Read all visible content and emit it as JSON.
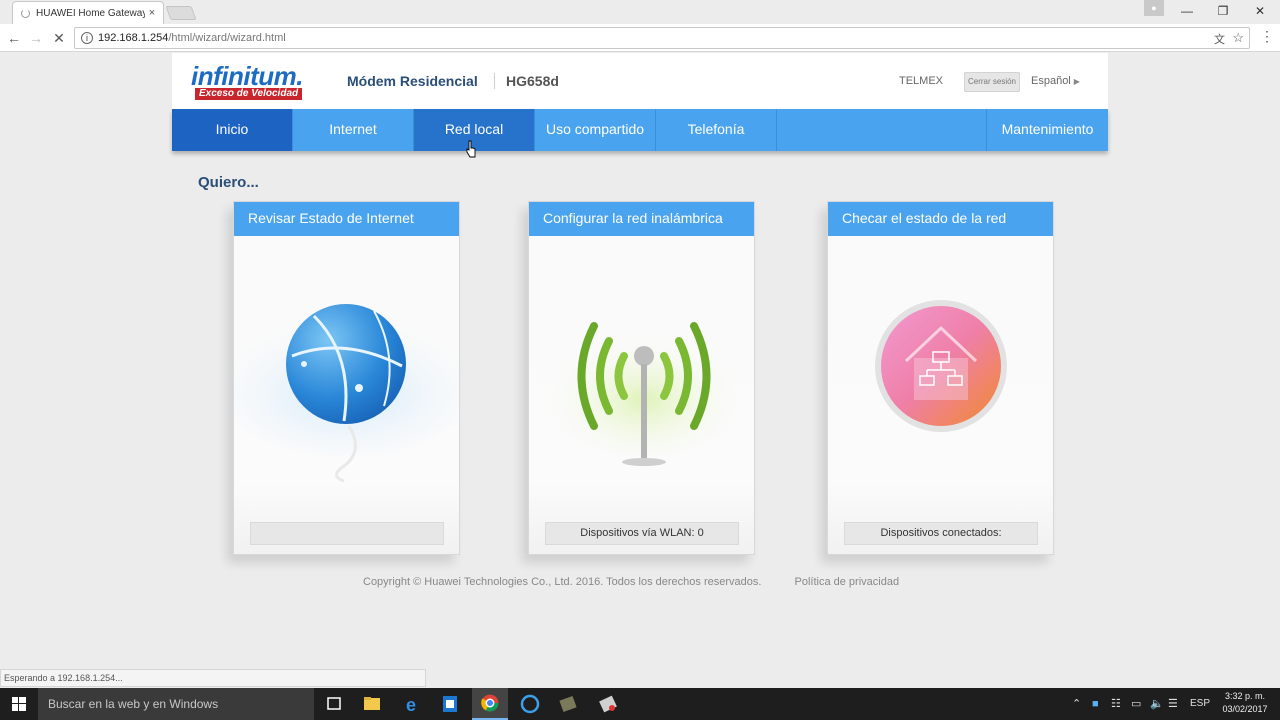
{
  "browser": {
    "tab_title": "HUAWEI Home Gateway",
    "tab_close": "×",
    "url_host": "192.168.1.254",
    "url_path": "/html/wizard/wizard.html",
    "status_text": "Esperando a 192.168.1.254..."
  },
  "header": {
    "logo_word": "infinitum.",
    "logo_tagline": "Exceso de Velocidad",
    "product_name": "Módem Residencial",
    "model": "HG658d",
    "isp": "TELMEX",
    "logout_label": "Cerrar sesión",
    "language": "Español"
  },
  "nav": {
    "items": [
      {
        "label": "Inicio"
      },
      {
        "label": "Internet"
      },
      {
        "label": "Red local"
      },
      {
        "label": "Uso compartido"
      },
      {
        "label": "Telefonía"
      },
      {
        "label": ""
      },
      {
        "label": "Mantenimiento"
      }
    ]
  },
  "main": {
    "heading": "Quiero...",
    "cards": [
      {
        "title": "Revisar Estado de Internet",
        "status": ""
      },
      {
        "title": "Configurar la red inalámbrica",
        "status": "Dispositivos vía WLAN: 0"
      },
      {
        "title": "Checar el estado de la red",
        "status": "Dispositivos conectados:"
      }
    ]
  },
  "footer": {
    "copyright": "Copyright © Huawei Technologies Co., Ltd. 2016. Todos los derechos reservados.",
    "privacy": "Política de privacidad"
  },
  "taskbar": {
    "search_placeholder": "Buscar en la web y en Windows",
    "language": "ESP",
    "time": "3:32 p. m.",
    "date": "03/02/2017"
  },
  "colors": {
    "nav_blue": "#4aa3ee",
    "nav_active": "#1d63c1",
    "logo_blue": "#1e6bc4",
    "logo_red": "#c9252c"
  }
}
